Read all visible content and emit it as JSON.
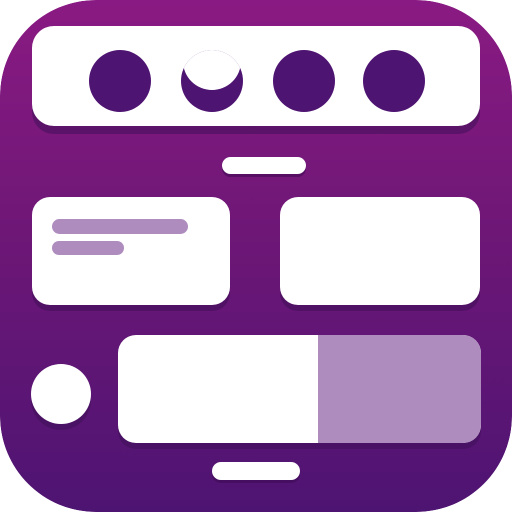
{
  "icon": {
    "name": "quick-settings-tiles-app-icon",
    "colors": {
      "background_top": "#8a1a83",
      "background_bottom": "#4e1472",
      "card": "#ffffff",
      "dot_dark": "#4e1472",
      "accent_light": "#ae8cbe",
      "shadow": "#3f1057"
    }
  },
  "top_bar": {
    "toggles": [
      {
        "icon": "circle-filled-icon",
        "state": "filled"
      },
      {
        "icon": "moon-eclipse-icon",
        "state": "partial"
      },
      {
        "icon": "circle-filled-icon",
        "state": "filled"
      },
      {
        "icon": "circle-filled-icon",
        "state": "filled"
      }
    ]
  },
  "tiles": {
    "left": {
      "lines": 2,
      "icon": "text-lines-icon"
    },
    "right": {
      "lines": 0
    }
  },
  "media_row": {
    "avatar_icon": "circle-avatar-icon",
    "slider_fill": 0.55
  }
}
